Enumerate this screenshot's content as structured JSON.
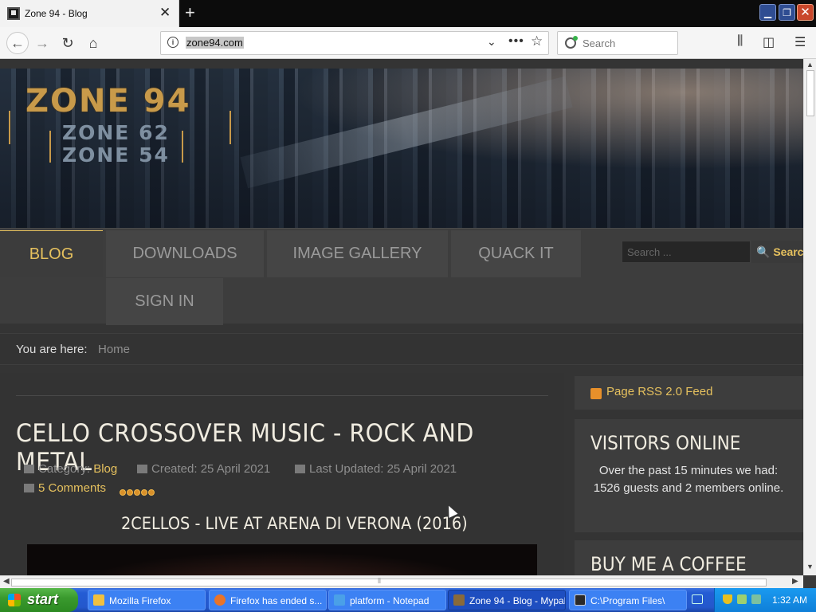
{
  "browser": {
    "tab_title": "Zone 94 - Blog",
    "url": "zone94.com",
    "search_placeholder": "Search"
  },
  "site": {
    "logo": {
      "main": "ZONE 94",
      "sub1": "ZONE 62",
      "sub2": "ZONE 54"
    },
    "menu": [
      {
        "label": "BLOG",
        "active": true
      },
      {
        "label": "DOWNLOADS",
        "active": false
      },
      {
        "label": "IMAGE GALLERY",
        "active": false
      },
      {
        "label": "QUACK IT",
        "active": false
      },
      {
        "label": "SIGN IN",
        "active": false
      }
    ],
    "search": {
      "placeholder": "Search ...",
      "button_label": "Search"
    },
    "breadcrumb": {
      "label": "You are here:",
      "home": "Home"
    }
  },
  "article": {
    "title": "CELLO CROSSOVER MUSIC - ROCK AND METAL",
    "category_label": "Category:",
    "category_value": "Blog",
    "created": "Created: 25 April 2021",
    "updated": "Last Updated: 25 April 2021",
    "comments": "5 Comments",
    "rating": 5,
    "subtitle": "2CELLOS - LIVE AT ARENA DI VERONA (2016)"
  },
  "sidebar": {
    "rss": "Page RSS 2.0 Feed",
    "visitors_heading": "VISITORS ONLINE",
    "visitors_text": "Over the past 15 minutes we had: 1526 guests and 2 members online.",
    "coffee_heading": "BUY ME A COFFEE"
  },
  "taskbar": {
    "start_label": "start",
    "tasks": [
      {
        "label": "Mozilla Firefox",
        "color": "#f0c040"
      },
      {
        "label": "Firefox has ended s...",
        "color": "#e8742a"
      },
      {
        "label": "platform - Notepad",
        "color": "#4aa0e8"
      },
      {
        "label": "Zone 94 - Blog - Mypal",
        "color": "#8a6a3a"
      },
      {
        "label": "C:\\Program Files\\",
        "color": "#2a2a2a"
      }
    ],
    "clock": "1:32 AM"
  },
  "colors": {
    "accent": "#e6c15e",
    "page_bg": "#343434"
  }
}
